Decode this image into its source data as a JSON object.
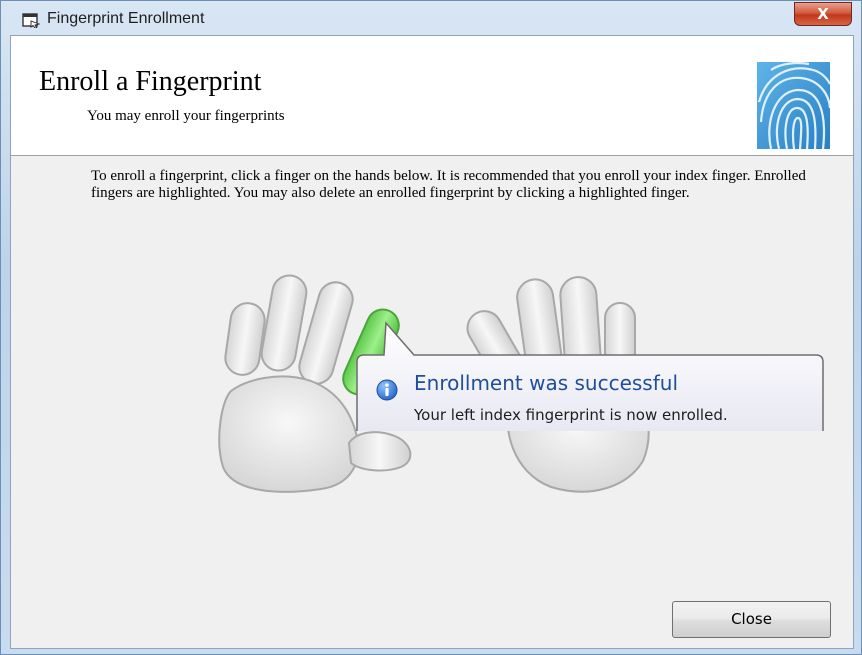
{
  "window": {
    "title": "Fingerprint Enrollment",
    "close_glyph": "X"
  },
  "header": {
    "title": "Enroll a Fingerprint",
    "subtitle": "You may enroll your fingerprints",
    "icon": "fingerprint-icon"
  },
  "instructions": "To enroll a fingerprint, click a finger on the hands below. It is recommended that you enroll your index finger. Enrolled fingers are highlighted. You may also delete an enrolled fingerprint by clicking a highlighted finger.",
  "hands": {
    "enrolled_finger": "left-index",
    "enrolled_color": "#7fdc6a",
    "finger_color": "#e8e8e8"
  },
  "balloon": {
    "icon": "info-icon",
    "title": "Enrollment was successful",
    "message": "Your left index fingerprint is now enrolled."
  },
  "buttons": {
    "close_label": "Close"
  },
  "colors": {
    "title_blue": "#1f4e9a",
    "enrolled_green": "#7fdc6a"
  }
}
